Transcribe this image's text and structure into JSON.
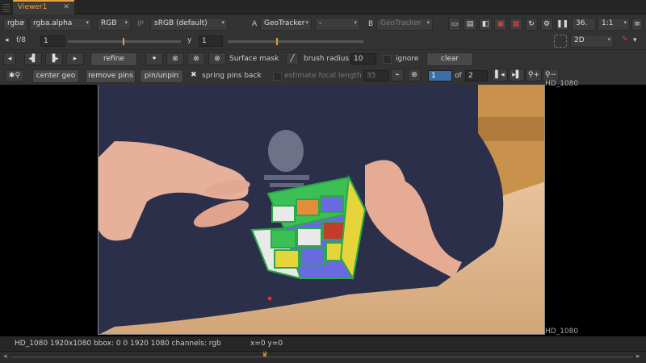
{
  "tabs": [
    {
      "label": "Viewer1",
      "close": "✕"
    }
  ],
  "toolbar": {
    "channels": "rgba",
    "alpha_channel": "rgba.alpha",
    "display": "RGB",
    "ip": "IP",
    "colorspace": "sRGB (default)",
    "input_a_label": "A",
    "input_a": "GeoTracker",
    "input_a_op": "-",
    "input_b_label": "B",
    "input_b": "GeoTracker",
    "zoom": "36.",
    "ratio": "1:1",
    "mode": "2D",
    "fstop": "f/8",
    "gain_value": "1",
    "gamma_label": "y",
    "gamma_value": "1"
  },
  "tracker": {
    "refine": "refine",
    "surface_mask": "Surface mask",
    "brush_radius_label": "brush radius",
    "brush_radius": "10",
    "ignore": "ignore",
    "clear": "clear",
    "center_geo": "center geo",
    "remove_pins": "remove pins",
    "pin_unpin": "pin/unpin",
    "spring_pins": "spring pins back",
    "estimate_focal": "estimate focal length",
    "focal_value": "35",
    "keyframe": "1",
    "of": "of",
    "keyframe_total": "2"
  },
  "viewer": {
    "format_tag": "HD_1080",
    "format_tag_top": "HD_1080"
  },
  "status": {
    "info": "HD_1080 1920x1080  bbox: 0 0 1920 1080 channels: rgb",
    "coords": "x=0 y=0"
  },
  "colors": {
    "accent": "#f0a040",
    "wire": "#2aa84a",
    "keyframe_field": "#3a6ea8",
    "pin": "#ff2020"
  },
  "cube_colors": [
    "#3cbf55",
    "#e9e9e9",
    "#6a6ae0",
    "#e38d3b",
    "#c33b2b",
    "#e5d53a"
  ]
}
